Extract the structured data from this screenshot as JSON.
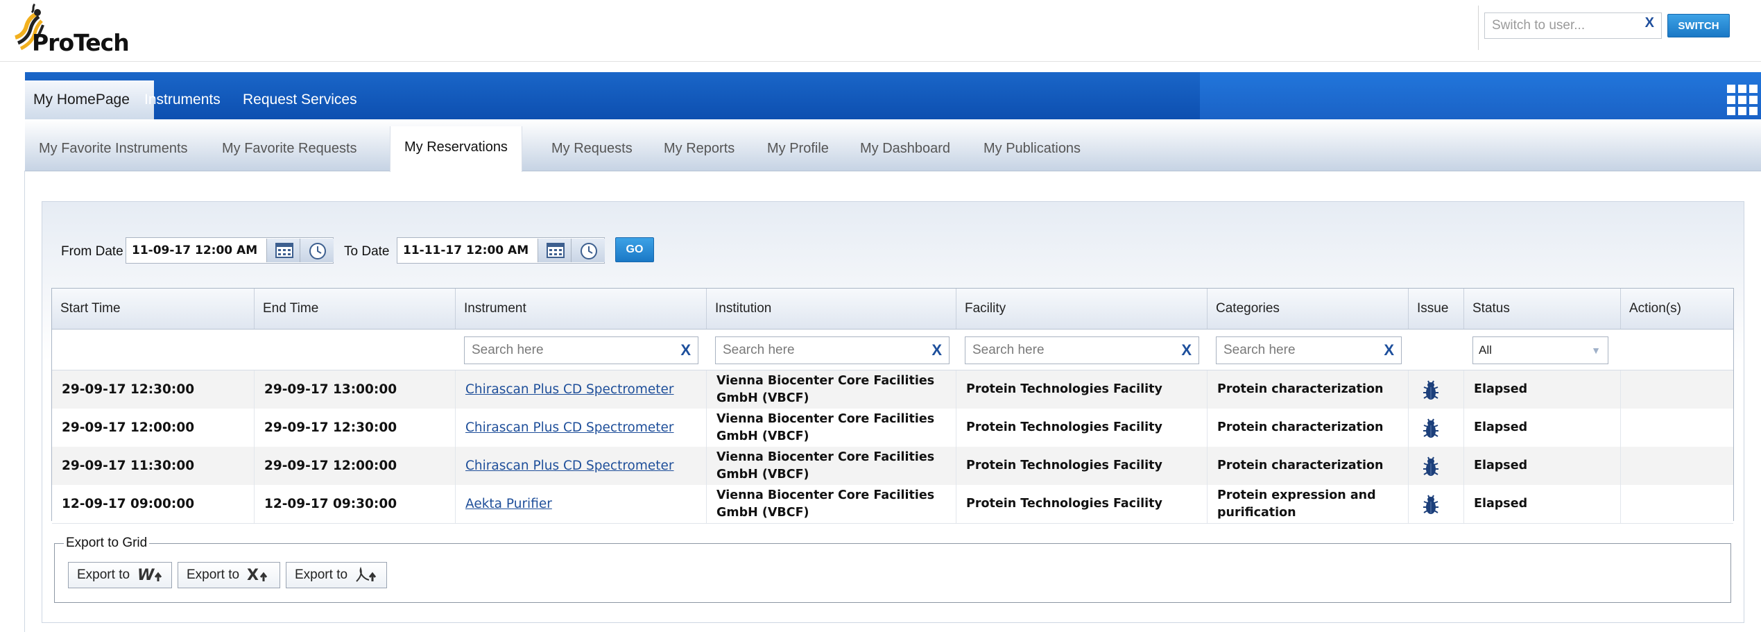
{
  "app": {
    "logo_text": "ProTech"
  },
  "switch_user": {
    "placeholder": "Switch to user...",
    "clear": "X",
    "button": "SWITCH"
  },
  "main_nav": {
    "tabs": [
      {
        "label": "My HomePage",
        "active": true
      },
      {
        "label": "Instruments",
        "active": false
      },
      {
        "label": "Request Services",
        "active": false
      }
    ]
  },
  "sub_nav": {
    "tabs": [
      {
        "label": "My Favorite Instruments",
        "active": false
      },
      {
        "label": "My Favorite Requests",
        "active": false
      },
      {
        "label": "My Reservations",
        "active": true
      },
      {
        "label": "My Requests",
        "active": false
      },
      {
        "label": "My Reports",
        "active": false
      },
      {
        "label": "My Profile",
        "active": false
      },
      {
        "label": "My Dashboard",
        "active": false
      },
      {
        "label": "My Publications",
        "active": false
      }
    ]
  },
  "date_filter": {
    "from_label": "From Date",
    "from_value": "11-09-17 12:00 AM",
    "to_label": "To Date",
    "to_value": "11-11-17 12:00 AM",
    "go_label": "GO"
  },
  "grid": {
    "columns": [
      "Start Time",
      "End Time",
      "Instrument",
      "Institution",
      "Facility",
      "Categories",
      "Issue",
      "Status",
      "Action(s)"
    ],
    "search_placeholder": "Search here",
    "clear_glyph": "X",
    "status_filter": "All",
    "rows": [
      {
        "start": "29-09-17 12:30:00",
        "end": "29-09-17 13:00:00",
        "instrument": "Chirascan Plus CD Spectrometer",
        "institution": "Vienna Biocenter Core Facilities GmbH (VBCF)",
        "facility": "Protein Technologies Facility",
        "category": "Protein characterization",
        "issue_icon": "bug-icon",
        "status": "Elapsed"
      },
      {
        "start": "29-09-17 12:00:00",
        "end": "29-09-17 12:30:00",
        "instrument": "Chirascan Plus CD Spectrometer",
        "institution": "Vienna Biocenter Core Facilities GmbH (VBCF)",
        "facility": "Protein Technologies Facility",
        "category": "Protein characterization",
        "issue_icon": "bug-icon",
        "status": "Elapsed"
      },
      {
        "start": "29-09-17 11:30:00",
        "end": "29-09-17 12:00:00",
        "instrument": "Chirascan Plus CD Spectrometer",
        "institution": "Vienna Biocenter Core Facilities GmbH (VBCF)",
        "facility": "Protein Technologies Facility",
        "category": "Protein characterization",
        "issue_icon": "bug-icon",
        "status": "Elapsed"
      },
      {
        "start": "12-09-17 09:00:00",
        "end": "12-09-17 09:30:00",
        "instrument": "Aekta Purifier",
        "institution": "Vienna Biocenter Core Facilities GmbH (VBCF)",
        "facility": "Protein Technologies Facility",
        "category": "Protein expression and purification",
        "issue_icon": "bug-icon",
        "status": "Elapsed"
      }
    ]
  },
  "export": {
    "legend": "Export to Grid",
    "buttons": [
      {
        "label": "Export to",
        "icon": "word-export-icon"
      },
      {
        "label": "Export to",
        "icon": "excel-export-icon"
      },
      {
        "label": "Export to",
        "icon": "pdf-export-icon"
      }
    ]
  },
  "colors": {
    "nav_blue": "#1a66c8",
    "button_blue": "#1a78c6",
    "link": "#1f4f9a"
  }
}
